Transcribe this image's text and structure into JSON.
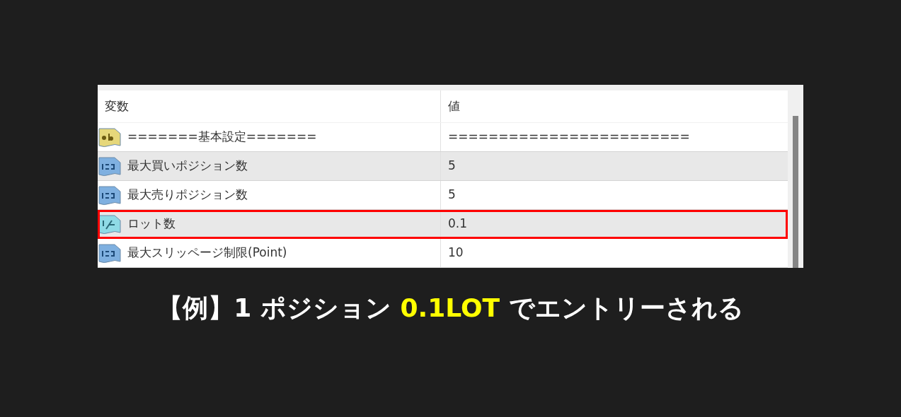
{
  "table": {
    "columns": [
      "変数",
      "値"
    ],
    "rows": [
      {
        "kind": "string",
        "variable": "=======基本設定=======",
        "value": "========================",
        "highlighted": false
      },
      {
        "kind": "int",
        "variable": "最大買いポジション数",
        "value": "5",
        "highlighted": false
      },
      {
        "kind": "int",
        "variable": "最大売りポジション数",
        "value": "5",
        "highlighted": false
      },
      {
        "kind": "double",
        "variable": "ロット数",
        "value": "0.1",
        "highlighted": true
      },
      {
        "kind": "int",
        "variable": "最大スリッページ制限(Point)",
        "value": "10",
        "highlighted": false
      }
    ]
  },
  "caption": [
    {
      "text": "【例】1 ポジション ",
      "emphasis": false
    },
    {
      "text": "0.1LOT",
      "emphasis": true
    },
    {
      "text": " でエントリーされる",
      "emphasis": false
    }
  ]
}
